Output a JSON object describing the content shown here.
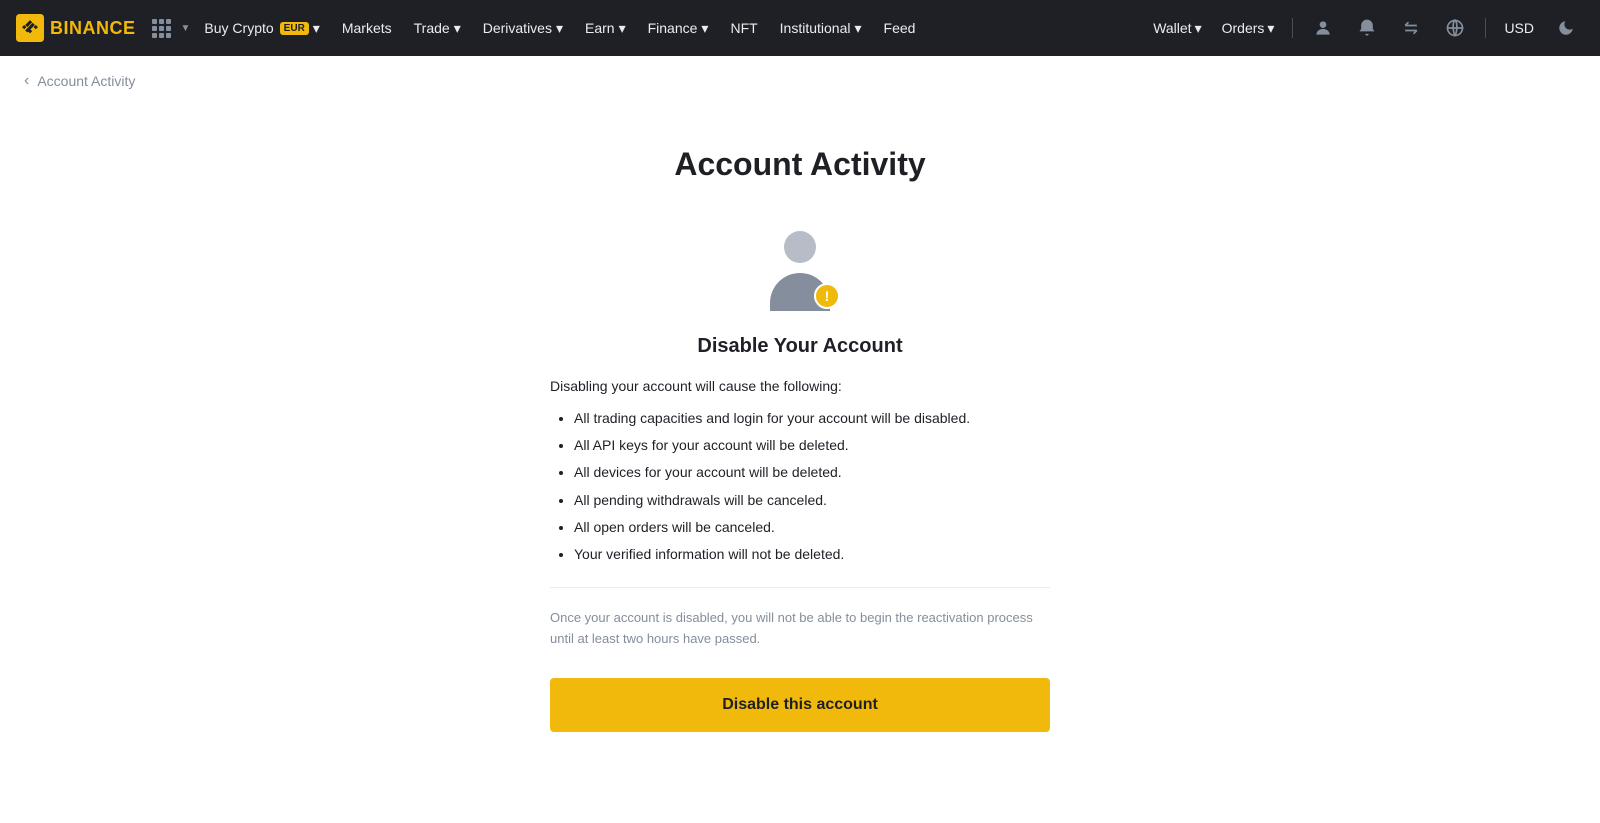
{
  "navbar": {
    "logo_text": "BINANCE",
    "items": [
      {
        "label": "Buy Crypto",
        "badge": "EUR",
        "has_chevron": true
      },
      {
        "label": "Markets",
        "has_chevron": false
      },
      {
        "label": "Trade",
        "has_chevron": true
      },
      {
        "label": "Derivatives",
        "has_chevron": true
      },
      {
        "label": "Earn",
        "has_chevron": true
      },
      {
        "label": "Finance",
        "has_chevron": true
      },
      {
        "label": "NFT",
        "has_chevron": false
      },
      {
        "label": "Institutional",
        "has_chevron": true
      },
      {
        "label": "Feed",
        "has_chevron": false
      }
    ],
    "right_items": [
      {
        "label": "Wallet",
        "has_chevron": true
      },
      {
        "label": "Orders",
        "has_chevron": true
      }
    ],
    "currency": "USD"
  },
  "breadcrumb": {
    "back_label": "‹",
    "title": "Account Activity"
  },
  "page": {
    "title": "Account Activity",
    "icon_warning": "!",
    "card_heading": "Disable Your Account",
    "intro_text": "Disabling your account will cause the following:",
    "list_items": [
      "All trading capacities and login for your account will be disabled.",
      "All API keys for your account will be deleted.",
      "All devices for your account will be deleted.",
      "All pending withdrawals will be canceled.",
      "All open orders will be canceled.",
      "Your verified information will not be deleted."
    ],
    "note_text": "Once your account is disabled, you will not be able to begin the reactivation process until at least two hours have passed.",
    "disable_button_label": "Disable this account"
  }
}
